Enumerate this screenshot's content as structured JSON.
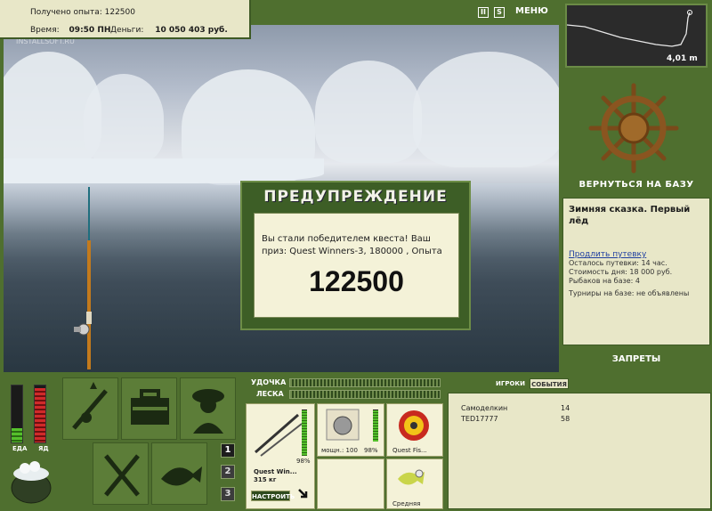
{
  "info": {
    "exp_label": "Получено опыта:",
    "exp_value": "122500",
    "time_label": "Время:",
    "time_value": "09:50 ПН",
    "money_label": "Деньги:",
    "money_value": "10 050 403 руб.",
    "watermark": "INSTALLSOFT.RU"
  },
  "top_controls": {
    "pause": "II",
    "sound": "S",
    "menu": "МЕНЮ"
  },
  "depth": {
    "value": "4,01 m"
  },
  "right_panel": {
    "back_label": "ВЕРНУТЬСЯ НА БАЗУ",
    "base_title": "Зимняя сказка. Первый лёд",
    "extend_link": "Продлить путевку",
    "rows": [
      "Осталось путевки: 14 час.",
      "Стоимость дня: 18 000 руб.",
      "Рыбаков на базе: 4",
      "Турниры на базе: не объявлены"
    ],
    "bans_label": "ЗАПРЕТЫ"
  },
  "modal": {
    "title": "ПРЕДУПРЕЖДЕНИЕ",
    "text": "Вы стали победителем квеста! Ваш приз: Quest Winners-3, 180000 , Опыта",
    "number": "122500"
  },
  "status": {
    "food_label": "ЕДА",
    "poison_label": "ЯД",
    "food_level": 0.25,
    "poison_level": 0.95
  },
  "pages": [
    "1",
    "2",
    "3"
  ],
  "tackle": {
    "rod_label": "УДОЧКА",
    "line_label": "ЛЕСКА",
    "rod_name": "Quest Win...",
    "rod_weight": "315 кг",
    "rod_pct": "98%",
    "reel_power": "мощн.: 100",
    "reel_pct": "98%",
    "line_name": "Quest Fis...",
    "bait_name": "Средняя",
    "tune_button": "НАСТРОИТЬ",
    "rod_level": 0.98,
    "reel_level": 0.98
  },
  "players": {
    "tab_players": "ИГРОКИ",
    "tab_events": "СОБЫТИЯ",
    "rows": [
      {
        "name": "Самоделкин",
        "value": "14"
      },
      {
        "name": "TED17777",
        "value": "58"
      }
    ]
  },
  "colors": {
    "panel": "#4f6f2f",
    "paper": "#e8e7c8",
    "accent_green": "#55c02c",
    "accent_red": "#c8202a"
  }
}
